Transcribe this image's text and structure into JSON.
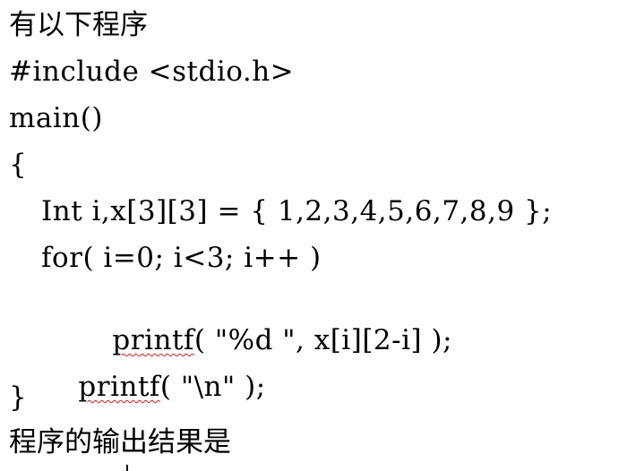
{
  "title": "有以下程序",
  "code": {
    "line1": "#include <stdio.h>",
    "line2": "main()",
    "line3": "{",
    "line4": "Int i,x[3][3] = { 1,2,3,4,5,6,7,8,9 };",
    "line5": "for( i=0; i<3; i++ )",
    "line6_fn": "printf",
    "line6_rest": "( \"%d \", x[i][2-i] );",
    "line7_fn": "printf",
    "line7_rest": "( \"\\n\" );",
    "line8": "}"
  },
  "question": "程序的输出结果是"
}
